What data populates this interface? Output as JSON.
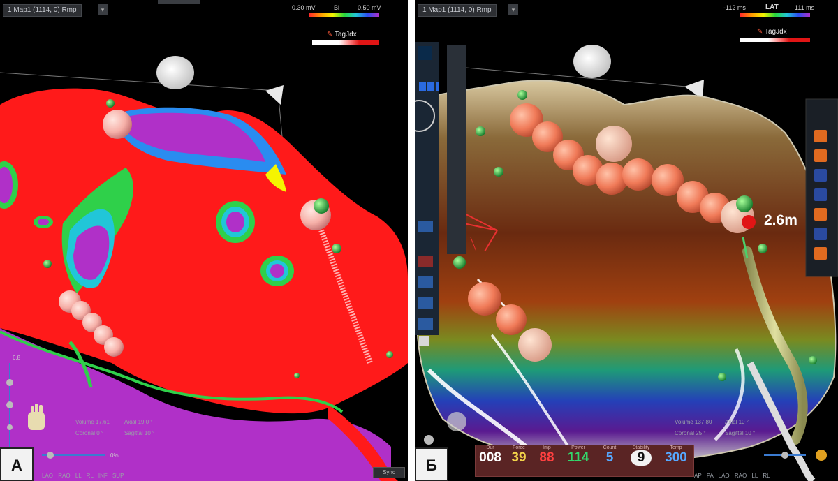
{
  "panels": [
    {
      "id": "A",
      "header": "1 Map1 (1114, 0) Rmp",
      "scale": {
        "min": "0.30 mV",
        "label": "Bi",
        "max": "0.50 mV"
      },
      "tag": "TagJdx",
      "label": "A",
      "info": {
        "volume": "Volume",
        "volume_val": "17.61",
        "axial": "Axial",
        "axial_val": "19.0 °",
        "coronal": "Coronal",
        "coronal_val": "0 °",
        "sagittal": "Sagittal",
        "sagittal_val": "10 °"
      },
      "zoom": "0%",
      "opacity": "6.8",
      "views": [
        "LAO",
        "RAO",
        "LL",
        "RL",
        "INF",
        "SUP"
      ],
      "sync": "Sync"
    },
    {
      "id": "B",
      "header": "1 Map1 (1114, 0) Rmp",
      "scale": {
        "min": "-112 ms",
        "label": "LAT",
        "max": "111 ms"
      },
      "tag": "TagJdx",
      "label": "Б",
      "distance": "2.6m",
      "info": {
        "volume": "Volume",
        "volume_val": "137.80",
        "axial": "Axial",
        "axial_val": "10 °",
        "coronal": "Coronal",
        "coronal_val": "25 °",
        "sagittal": "Sagittal",
        "sagittal_val": "10 °"
      },
      "views": [
        "AP",
        "PA",
        "LAO",
        "RAO",
        "LL",
        "RL"
      ],
      "status": [
        {
          "name": "Dur",
          "value": "008",
          "color": "#ffffff"
        },
        {
          "name": "Force",
          "value": "39",
          "color": "#f2d34a"
        },
        {
          "name": "Imp",
          "value": "88",
          "color": "#ff4040"
        },
        {
          "name": "Power",
          "value": "114",
          "color": "#33d66b"
        },
        {
          "name": "Count",
          "value": "5",
          "color": "#56a8ff"
        },
        {
          "name": "Stability",
          "value": "9",
          "color": "#111111"
        },
        {
          "name": "Temp",
          "value": "300",
          "color": "#56a8ff"
        }
      ]
    }
  ],
  "colors": {
    "red": "#ff1a1a",
    "purple": "#b030c8",
    "green": "#2fd04a",
    "white": "#ffffff"
  }
}
